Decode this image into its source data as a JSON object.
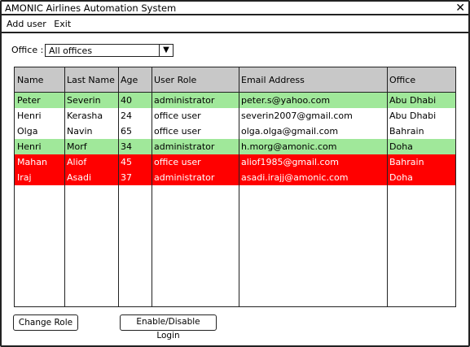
{
  "window": {
    "title": "AMONIC Airlines Automation System",
    "close_glyph": "✕"
  },
  "menu": {
    "add_user": "Add user",
    "exit": "Exit"
  },
  "filter": {
    "label": "Office :",
    "selected": "All offices",
    "arrow": "▼"
  },
  "table": {
    "columns": [
      "Name",
      "Last Name",
      "Age",
      "User Role",
      "Email Address",
      "Office"
    ],
    "rows": [
      {
        "cells": [
          "Peter",
          "Severin",
          "40",
          "administrator",
          "peter.s@yahoo.com",
          "Abu Dhabi"
        ],
        "bg": "#a0e89a",
        "fg": "#000000"
      },
      {
        "cells": [
          "Henri",
          "Kerasha",
          "24",
          "office user",
          "severin2007@gmail.com",
          "Abu Dhabi"
        ],
        "bg": "#ffffff",
        "fg": "#000000"
      },
      {
        "cells": [
          "Olga",
          "Navin",
          "65",
          "office user",
          "olga.olga@gmail.com",
          "Bahrain"
        ],
        "bg": "#ffffff",
        "fg": "#000000"
      },
      {
        "cells": [
          "Henri",
          "Morf",
          "34",
          "administrator",
          "h.morg@amonic.com",
          "Doha"
        ],
        "bg": "#a0e89a",
        "fg": "#000000"
      },
      {
        "cells": [
          "Mahan",
          "Aliof",
          "45",
          "office user",
          "aliof1985@gmail.com",
          "Bahrain"
        ],
        "bg": "#ff0000",
        "fg": "#ffffff"
      },
      {
        "cells": [
          "Iraj",
          "Asadi",
          "37",
          "administrator",
          "asadi.irajj@amonic.com",
          "Doha"
        ],
        "bg": "#ff0000",
        "fg": "#ffffff"
      }
    ]
  },
  "buttons": {
    "change_role": "Change Role",
    "enable_disable": "Enable/Disable Login"
  }
}
